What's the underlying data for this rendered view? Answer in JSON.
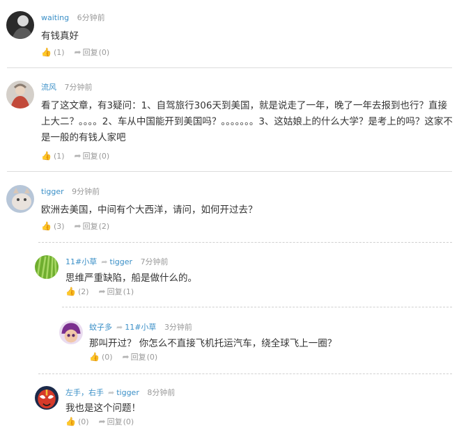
{
  "comments": [
    {
      "user": "waiting",
      "time": "6分钟前",
      "text": "有钱真好",
      "likes": "(1)",
      "reply_label": "回复",
      "replies": "(0)"
    },
    {
      "user": "流风",
      "time": "7分钟前",
      "text": "看了这文章，有3疑问：1、自驾旅行306天到美国，就是说走了一年，晚了一年去报到也行？直接上大二？。。。。2、车从中国能开到美国吗？。。。。。。。3、这姑娘上的什么大学？是考上的吗？这家不是一般的有钱人家吧",
      "likes": "(1)",
      "reply_label": "回复",
      "replies": "(0)"
    },
    {
      "user": "tigger",
      "time": "9分钟前",
      "text": "欧洲去美国，中间有个大西洋，请问，如何开过去？",
      "likes": "(3)",
      "reply_label": "回复",
      "replies": "(2)"
    },
    {
      "user": "11#小草",
      "reply_to": "tigger",
      "time": "7分钟前",
      "text": "思维严重缺陷，船是做什么的。",
      "likes": "(2)",
      "reply_label": "回复",
      "replies": "(1)"
    },
    {
      "user": "蚊子多",
      "reply_to": "11#小草",
      "time": "3分钟前",
      "text": "那叫开过？ 你怎么不直接飞机托运汽车，绕全球飞上一圈？",
      "likes": "(0)",
      "reply_label": "回复",
      "replies": "(0)"
    },
    {
      "user": "左手，右手",
      "reply_to": "tigger",
      "time": "8分钟前",
      "text": "我也是这个问题！",
      "likes": "(0)",
      "reply_label": "回复",
      "replies": "(0)"
    }
  ],
  "icons": {
    "like": "thumbs-up-icon",
    "reply": "share-arrow-icon",
    "reply_to": "reply-to-arrow-icon"
  },
  "colors": {
    "username": "#3a8fc7",
    "meta": "#999999",
    "text": "#333333",
    "divider": "#dcdcdc"
  }
}
